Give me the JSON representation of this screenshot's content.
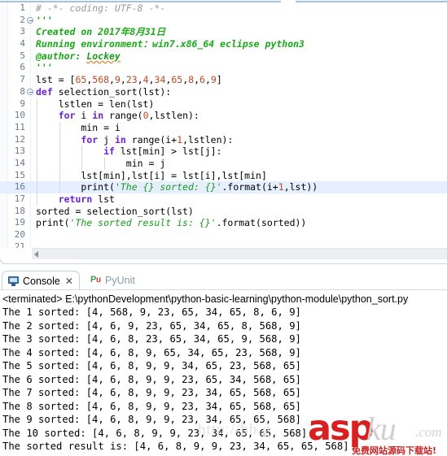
{
  "editor": {
    "highlighted_line": 16,
    "lines": [
      {
        "n": "1",
        "fold": false,
        "segments": [
          {
            "t": "# -*- coding: UTF-8 -*-",
            "c": "c-comment"
          }
        ]
      },
      {
        "n": "2",
        "fold": true,
        "segments": [
          {
            "t": "'''",
            "c": "c-doc"
          }
        ]
      },
      {
        "n": "3",
        "fold": false,
        "segments": [
          {
            "t": "Created on 2017年8月31日",
            "c": "c-doc"
          }
        ]
      },
      {
        "n": "4",
        "fold": false,
        "segments": [
          {
            "t": "Running environment：win7.x86_64 eclipse python3",
            "c": "c-doc"
          }
        ]
      },
      {
        "n": "5",
        "fold": false,
        "segments": [
          {
            "t": "@author: ",
            "c": "c-doc"
          },
          {
            "t": "Lockey",
            "c": "c-author"
          }
        ]
      },
      {
        "n": "6",
        "fold": false,
        "segments": [
          {
            "t": "'''",
            "c": "c-doc"
          }
        ]
      },
      {
        "n": "7",
        "fold": false,
        "segments": [
          {
            "t": "lst = [",
            "c": "c-plain"
          },
          {
            "t": "65",
            "c": "c-num"
          },
          {
            "t": ",",
            "c": "c-plain"
          },
          {
            "t": "568",
            "c": "c-num"
          },
          {
            "t": ",",
            "c": "c-plain"
          },
          {
            "t": "9",
            "c": "c-num"
          },
          {
            "t": ",",
            "c": "c-plain"
          },
          {
            "t": "23",
            "c": "c-num"
          },
          {
            "t": ",",
            "c": "c-plain"
          },
          {
            "t": "4",
            "c": "c-num"
          },
          {
            "t": ",",
            "c": "c-plain"
          },
          {
            "t": "34",
            "c": "c-num"
          },
          {
            "t": ",",
            "c": "c-plain"
          },
          {
            "t": "65",
            "c": "c-num"
          },
          {
            "t": ",",
            "c": "c-plain"
          },
          {
            "t": "8",
            "c": "c-num"
          },
          {
            "t": ",",
            "c": "c-plain"
          },
          {
            "t": "6",
            "c": "c-num"
          },
          {
            "t": ",",
            "c": "c-plain"
          },
          {
            "t": "9",
            "c": "c-num"
          },
          {
            "t": "]",
            "c": "c-plain"
          }
        ]
      },
      {
        "n": "8",
        "fold": true,
        "segments": [
          {
            "t": "def ",
            "c": "c-kw"
          },
          {
            "t": "selection_sort(lst):",
            "c": "c-plain"
          }
        ]
      },
      {
        "n": "9",
        "fold": false,
        "segments": [
          {
            "t": "    lstlen = len(lst)",
            "c": "c-plain"
          }
        ]
      },
      {
        "n": "10",
        "fold": false,
        "segments": [
          {
            "t": "    ",
            "c": "c-plain"
          },
          {
            "t": "for ",
            "c": "c-kw"
          },
          {
            "t": "i ",
            "c": "c-plain"
          },
          {
            "t": "in ",
            "c": "c-kw"
          },
          {
            "t": "range(",
            "c": "c-plain"
          },
          {
            "t": "0",
            "c": "c-num"
          },
          {
            "t": ",lstlen):",
            "c": "c-plain"
          }
        ]
      },
      {
        "n": "11",
        "fold": false,
        "segments": [
          {
            "t": "        min = i",
            "c": "c-plain"
          }
        ]
      },
      {
        "n": "12",
        "fold": false,
        "segments": [
          {
            "t": "        ",
            "c": "c-plain"
          },
          {
            "t": "for ",
            "c": "c-kw"
          },
          {
            "t": "j ",
            "c": "c-plain"
          },
          {
            "t": "in ",
            "c": "c-kw"
          },
          {
            "t": "range(i+",
            "c": "c-plain"
          },
          {
            "t": "1",
            "c": "c-num"
          },
          {
            "t": ",lstlen):",
            "c": "c-plain"
          }
        ]
      },
      {
        "n": "13",
        "fold": false,
        "segments": [
          {
            "t": "            ",
            "c": "c-plain"
          },
          {
            "t": "if ",
            "c": "c-kw"
          },
          {
            "t": "lst[min] > lst[j]:",
            "c": "c-plain"
          }
        ]
      },
      {
        "n": "14",
        "fold": false,
        "segments": [
          {
            "t": "                min = j",
            "c": "c-plain"
          }
        ]
      },
      {
        "n": "15",
        "fold": false,
        "segments": [
          {
            "t": "        lst[min],lst[i] = lst[i],lst[min]",
            "c": "c-plain"
          }
        ]
      },
      {
        "n": "16",
        "fold": false,
        "segments": [
          {
            "t": "        print(",
            "c": "c-plain"
          },
          {
            "t": "'The {} sorted: {}'",
            "c": "c-str"
          },
          {
            "t": ".format(i+",
            "c": "c-plain"
          },
          {
            "t": "1",
            "c": "c-num"
          },
          {
            "t": ",lst))",
            "c": "c-plain"
          }
        ]
      },
      {
        "n": "17",
        "fold": false,
        "segments": [
          {
            "t": "    ",
            "c": "c-plain"
          },
          {
            "t": "return ",
            "c": "c-kw"
          },
          {
            "t": "lst",
            "c": "c-plain"
          }
        ]
      },
      {
        "n": "18",
        "fold": false,
        "segments": [
          {
            "t": "sorted = selection_sort(lst)",
            "c": "c-plain"
          }
        ]
      },
      {
        "n": "19",
        "fold": false,
        "segments": [
          {
            "t": "print(",
            "c": "c-plain"
          },
          {
            "t": "'The sorted result is: {}'",
            "c": "c-str"
          },
          {
            "t": ".format(sorted))",
            "c": "c-plain"
          }
        ]
      },
      {
        "n": "20",
        "fold": false,
        "segments": [
          {
            "t": "",
            "c": "c-plain"
          }
        ]
      },
      {
        "n": "21",
        "fold": false,
        "segments": [
          {
            "t": "",
            "c": "c-plain"
          }
        ]
      }
    ],
    "scrollbar": {
      "arrow_icon": "scroll-left-arrow-icon"
    }
  },
  "console": {
    "tabs": [
      {
        "label": "Console",
        "icon": "console-monitor-icon",
        "close_icon": "✕",
        "active": true
      },
      {
        "label": "PyUnit",
        "icon": "pyunit-icon",
        "active": false
      }
    ],
    "terminated_line": "<terminated> E:\\pythonDevelopment\\python-basic-learning\\python-module\\python_sort.py",
    "output": [
      "The 1 sorted: [4, 568, 9, 23, 65, 34, 65, 8, 6, 9]",
      "The 2 sorted: [4, 6, 9, 23, 65, 34, 65, 8, 568, 9]",
      "The 3 sorted: [4, 6, 8, 23, 65, 34, 65, 9, 568, 9]",
      "The 4 sorted: [4, 6, 8, 9, 65, 34, 65, 23, 568, 9]",
      "The 5 sorted: [4, 6, 8, 9, 9, 34, 65, 23, 568, 65]",
      "The 6 sorted: [4, 6, 8, 9, 9, 23, 65, 34, 568, 65]",
      "The 7 sorted: [4, 6, 8, 9, 9, 23, 34, 65, 568, 65]",
      "The 8 sorted: [4, 6, 8, 9, 9, 23, 34, 65, 568, 65]",
      "The 9 sorted: [4, 6, 8, 9, 9, 23, 34, 65, 65, 568]",
      "The 10 sorted: [4, 6, 8, 9, 9, 23, 34, 65, 65, 568]",
      "The sorted result is: [4, 6, 8, 9, 9, 23, 34, 65, 65, 568]"
    ]
  },
  "watermark": {
    "url_text": "http://bb.g",
    "logo_asp": "asp",
    "logo_ku": "ku",
    "logo_com": ".com",
    "tagline": "免费网站源码下载站!"
  },
  "colors": {
    "accent_blue": "#3b78b8",
    "highlight_line": "#e5efff",
    "string_green": "#1a9c1a",
    "keyword_purple": "#6a22d6",
    "number_orange": "#b84a1f",
    "comment_gray": "#9a9a9a",
    "logo_red": "#d92020"
  }
}
